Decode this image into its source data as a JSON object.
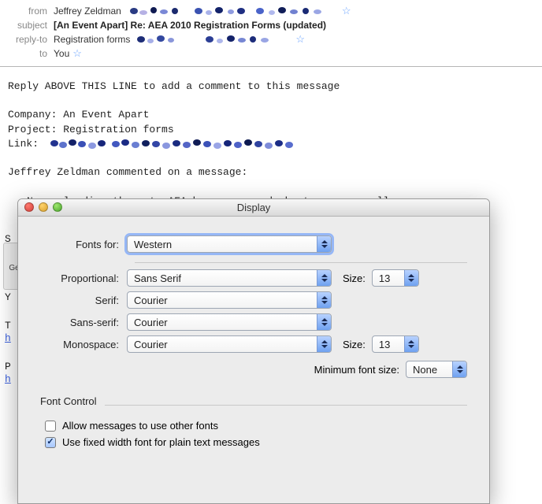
{
  "email": {
    "headers": {
      "from_label": "from",
      "from_value": "Jeffrey Zeldman",
      "subject_label": "subject",
      "subject_value": "[An Event Apart] Re: AEA 2010 Registration Forms (updated)",
      "replyto_label": "reply-to",
      "replyto_value": "Registration forms",
      "to_label": "to",
      "to_value": "You"
    },
    "body": {
      "notice": "Reply ABOVE THIS LINE to add a comment to this message",
      "company_line": "Company: An Event Apart",
      "project_line": "Project: Registration forms",
      "link_label": "Link:",
      "comment_intro": "Jeffrey Zeldman commented on a message:",
      "comment_body": "Now uploading these to AEA home page and about page as well."
    }
  },
  "toolbar_peek_label": "Ge",
  "side_letters": {
    "s": "S",
    "y": "Y",
    "t": "T",
    "h1": "h",
    "p": "P",
    "h2": "h"
  },
  "display_window": {
    "title": "Display",
    "fonts_for_label": "Fonts for:",
    "fonts_for_value": "Western",
    "proportional_label": "Proportional:",
    "proportional_value": "Sans Serif",
    "proportional_size_label": "Size:",
    "proportional_size_value": "13",
    "serif_label": "Serif:",
    "serif_value": "Courier",
    "sans_label": "Sans-serif:",
    "sans_value": "Courier",
    "mono_label": "Monospace:",
    "mono_value": "Courier",
    "mono_size_label": "Size:",
    "mono_size_value": "13",
    "min_font_label": "Minimum font size:",
    "min_font_value": "None",
    "font_control_title": "Font Control",
    "allow_other_fonts_label": "Allow messages to use other fonts",
    "allow_other_fonts_checked": false,
    "fixed_width_label": "Use fixed width font for plain text messages",
    "fixed_width_checked": true
  }
}
